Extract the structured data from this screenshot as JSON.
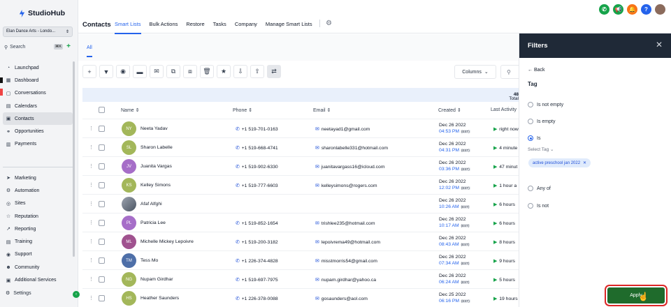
{
  "app": {
    "name": "StudioHub",
    "account": "Elan Dance Arts - Londo...",
    "search_label": "Search",
    "search_shortcut": "⌘K"
  },
  "nav": {
    "primary": [
      {
        "label": "Launchpad",
        "icon": "rocket-icon"
      },
      {
        "label": "Dashboard",
        "icon": "dashboard-icon"
      },
      {
        "label": "Conversations",
        "icon": "chat-icon"
      },
      {
        "label": "Calendars",
        "icon": "calendar-icon"
      },
      {
        "label": "Contacts",
        "icon": "contacts-icon",
        "active": true
      },
      {
        "label": "Opportunities",
        "icon": "funnel-icon"
      },
      {
        "label": "Payments",
        "icon": "payments-icon"
      }
    ],
    "secondary": [
      {
        "label": "Marketing",
        "icon": "send-icon"
      },
      {
        "label": "Automation",
        "icon": "automation-icon"
      },
      {
        "label": "Sites",
        "icon": "globe-icon"
      },
      {
        "label": "Reputation",
        "icon": "star-icon"
      },
      {
        "label": "Reporting",
        "icon": "chart-icon"
      },
      {
        "label": "Training",
        "icon": "training-icon"
      },
      {
        "label": "Support",
        "icon": "support-icon"
      },
      {
        "label": "Community",
        "icon": "community-icon"
      },
      {
        "label": "Additional Services",
        "icon": "services-icon"
      }
    ],
    "settings": "Settings"
  },
  "header": {
    "title": "Contacts",
    "tabs": [
      "Smart Lists",
      "Bulk Actions",
      "Restore",
      "Tasks",
      "Company",
      "Manage Smart Lists"
    ],
    "active_tab": "Smart Lists"
  },
  "subtabs": {
    "all": "All"
  },
  "toolbar": {
    "columns_label": "Columns"
  },
  "table": {
    "total_label": "Total",
    "total_value": "48",
    "headers": {
      "name": "Name",
      "phone": "Phone",
      "email": "Email",
      "created": "Created",
      "last_activity": "Last Activity"
    },
    "rows": [
      {
        "initials": "NY",
        "color": "#a3b75a",
        "name": "Neeta Yadav",
        "phone": "+1 519-701-0163",
        "email": "neetayad1@gmail.com",
        "date": "Dec 26 2022",
        "time": "04:53 PM",
        "tz": "(EST)",
        "activity": "right now"
      },
      {
        "initials": "SL",
        "color": "#a3b75a",
        "name": "Sharon Labelle",
        "phone": "+1 519-668-4741",
        "email": "sharonlabelle331@hotmail.com",
        "date": "Dec 26 2022",
        "time": "04:31 PM",
        "tz": "(EST)",
        "activity": "4 minute"
      },
      {
        "initials": "JV",
        "color": "#a66ec8",
        "name": "Juanita Vargas",
        "phone": "+1 519-902-6330",
        "email": "juanitavargass16@icloud.com",
        "date": "Dec 26 2022",
        "time": "03:36 PM",
        "tz": "(EST)",
        "activity": "47 minut"
      },
      {
        "initials": "KS",
        "color": "#a3b75a",
        "name": "Kelley Simons",
        "phone": "+1 519-777-6603",
        "email": "kelleysimons@rogers.com",
        "date": "Dec 26 2022",
        "time": "12:02 PM",
        "tz": "(EST)",
        "activity": "1 hour a"
      },
      {
        "initials": "",
        "color": "#6b7280",
        "photo": true,
        "name": "Afaf Alfghi",
        "phone": "",
        "email": "",
        "date": "Dec 26 2022",
        "time": "10:26 AM",
        "tz": "(EST)",
        "activity": "6 hours"
      },
      {
        "initials": "PL",
        "color": "#a66ec8",
        "name": "Patricia Lee",
        "phone": "+1 519-852-1654",
        "email": "trishlee235@hotmail.com",
        "date": "Dec 26 2022",
        "time": "10:17 AM",
        "tz": "(EST)",
        "activity": "6 hours"
      },
      {
        "initials": "ML",
        "color": "#a0528f",
        "name": "Michelle Mickey Lepoivre",
        "phone": "+1 519-200-3182",
        "email": "lepoivrema49@hotmail.com",
        "date": "Dec 26 2022",
        "time": "08:43 AM",
        "tz": "(EST)",
        "activity": "8 hours"
      },
      {
        "initials": "TM",
        "color": "#4e6fa8",
        "name": "Tess Mo",
        "phone": "+1 226-374-4828",
        "email": "misstmorris54@gmail.com",
        "date": "Dec 26 2022",
        "time": "07:34 AM",
        "tz": "(EST)",
        "activity": "9 hours"
      },
      {
        "initials": "NG",
        "color": "#a3b75a",
        "name": "Nupam Girdhar",
        "phone": "+1 519-697-7975",
        "email": "nupam.girdhar@yahoo.ca",
        "date": "Dec 26 2022",
        "time": "06:24 AM",
        "tz": "(EST)",
        "activity": "5 hours"
      },
      {
        "initials": "HS",
        "color": "#a3b75a",
        "name": "Heather Saunders",
        "phone": "+1 226-378-0088",
        "email": "gosaunders@aol.com",
        "date": "Dec 25 2022",
        "time": "06:16 PM",
        "tz": "(EST)",
        "activity": "19 hours"
      }
    ]
  },
  "filters": {
    "title": "Filters",
    "back": "Back",
    "field": "Tag",
    "options": [
      {
        "label": "Is not empty",
        "selected": false
      },
      {
        "label": "Is empty",
        "selected": false
      },
      {
        "label": "Is",
        "selected": true
      },
      {
        "label": "Any of",
        "selected": false
      },
      {
        "label": "Is not",
        "selected": false
      }
    ],
    "select_tag_label": "Select Tag",
    "chip": "active preschool jan 2022",
    "apply": "Apply"
  }
}
